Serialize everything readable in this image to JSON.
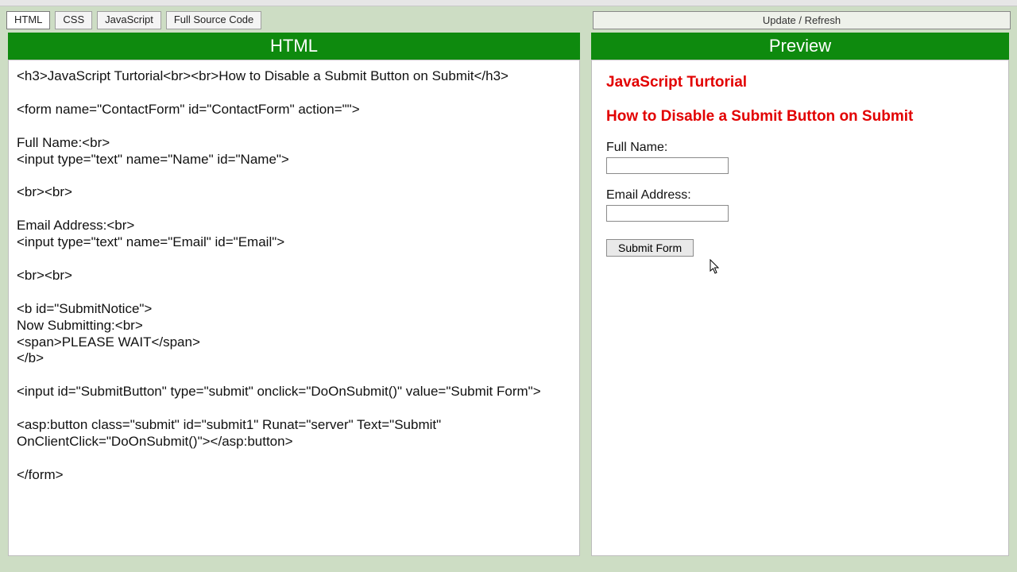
{
  "tabs": {
    "html": "HTML",
    "css": "CSS",
    "js": "JavaScript",
    "full": "Full Source Code"
  },
  "refresh_label": "Update  /  Refresh",
  "panel_titles": {
    "left": "HTML",
    "right": "Preview"
  },
  "source_code": "<h3>JavaScript Turtorial<br><br>How to Disable a Submit Button on Submit</h3>\n\n<form name=\"ContactForm\" id=\"ContactForm\" action=\"\">\n\nFull Name:<br>\n<input type=\"text\" name=\"Name\" id=\"Name\">\n\n<br><br>\n\nEmail Address:<br>\n<input type=\"text\" name=\"Email\" id=\"Email\">\n\n<br><br>\n\n<b id=\"SubmitNotice\">\nNow Submitting:<br>\n<span>PLEASE WAIT</span>\n</b>\n\n<input id=\"SubmitButton\" type=\"submit\" onclick=\"DoOnSubmit()\" value=\"Submit Form\">\n\n<asp:button class=\"submit\" id=\"submit1\" Runat=\"server\" Text=\"Submit\" OnClientClick=\"DoOnSubmit()\"></asp:button>\n\n</form>",
  "preview": {
    "h3_line1": "JavaScript Turtorial",
    "h3_line2": "How to Disable a Submit Button on Submit",
    "label_fullname": "Full Name:",
    "label_email": "Email Address:",
    "submit_value": "Submit Form"
  }
}
